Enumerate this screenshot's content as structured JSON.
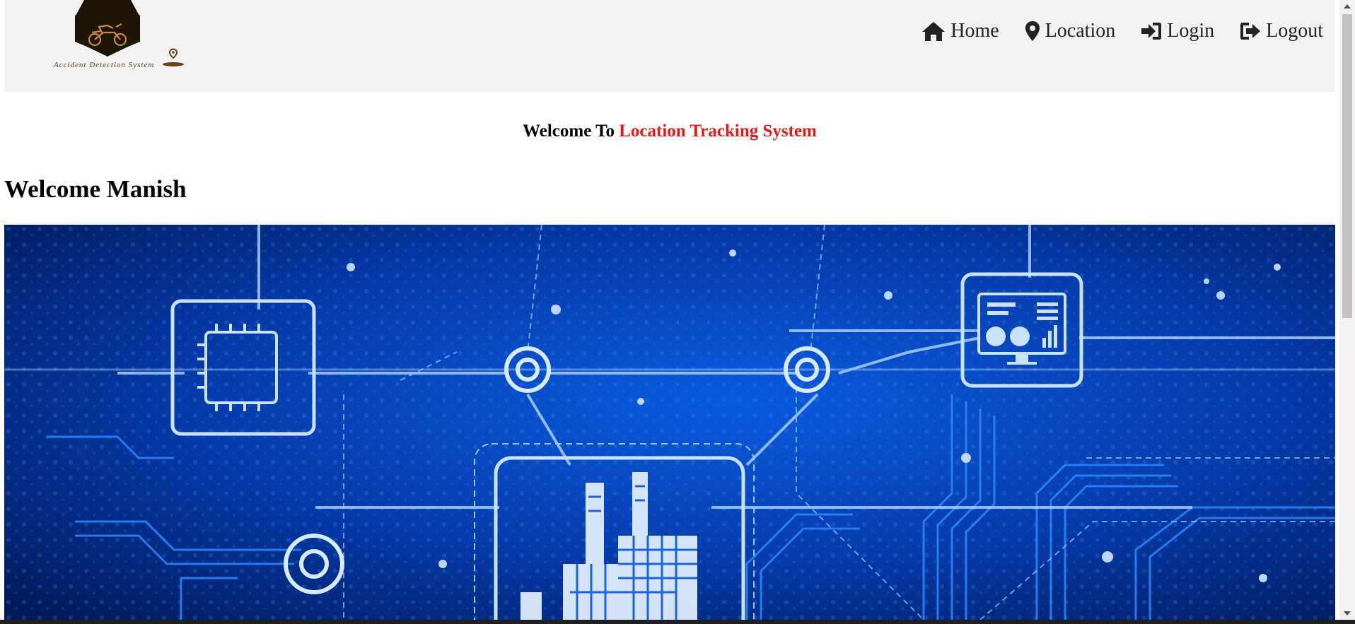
{
  "logo": {
    "caption": "Accident Detection System",
    "colors": {
      "hexagon": "#1e1407",
      "motorbike": "#c98b3a",
      "pin": "#6a3f12"
    }
  },
  "nav": {
    "items": [
      {
        "label": "Home",
        "icon": "home-icon"
      },
      {
        "label": "Location",
        "icon": "map-pin-icon"
      },
      {
        "label": "Login",
        "icon": "sign-in-icon"
      },
      {
        "label": "Logout",
        "icon": "sign-out-icon"
      }
    ]
  },
  "welcome": {
    "prefix": "Welcome To",
    "highlight": "Location Tracking System",
    "highlight_color": "#e21a1a"
  },
  "user": {
    "greeting": "Welcome Manish"
  },
  "hero": {
    "content": "circuit-board-image",
    "colors": {
      "dark": "#021a5a",
      "mid": "#0a4fc9",
      "trace": "#2f86ff",
      "glow": "#bfe0ff"
    }
  },
  "scrollbar": {
    "track": "#f1f1f1",
    "thumb": "#c1c1c1"
  }
}
